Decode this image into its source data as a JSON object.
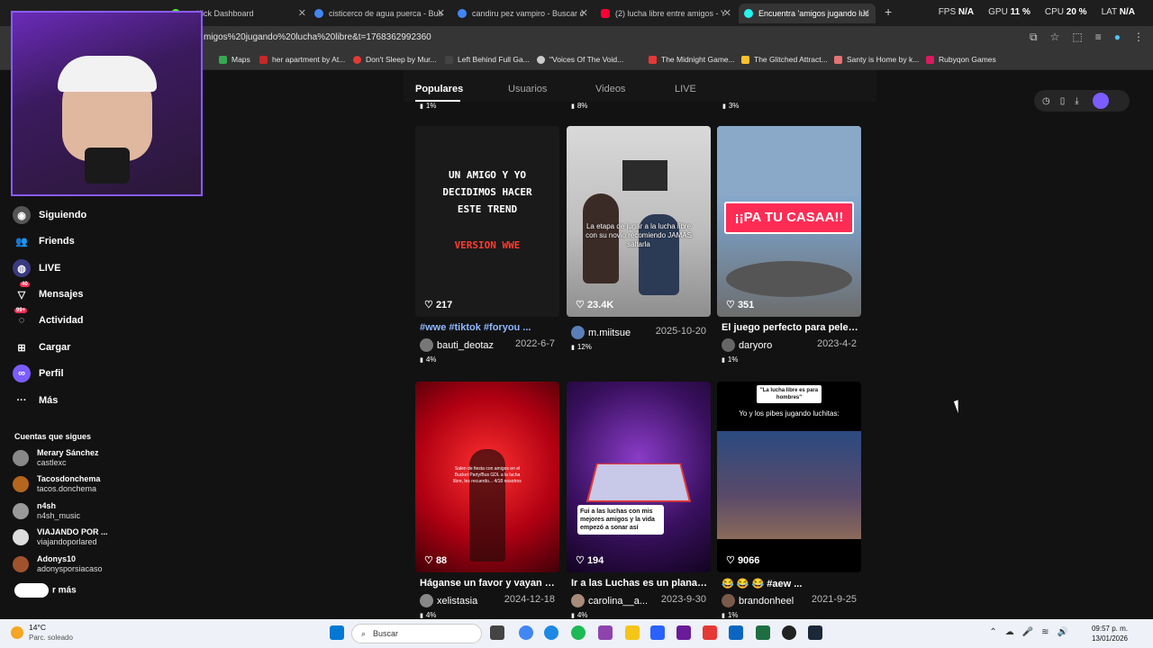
{
  "browser": {
    "tabs": [
      {
        "label": "Kick Dashboard"
      },
      {
        "label": "cisticerco de agua puerca - Bus"
      },
      {
        "label": "candiru pez vampiro - Buscar c"
      },
      {
        "label": "(2) lucha libre entre amigos - Y"
      },
      {
        "label": "Encuentra 'amigos jugando luc"
      }
    ],
    "url": "migos%20jugando%20lucha%20libre&t=1768362992360",
    "hud": {
      "fps_label": "FPS",
      "fps_value": "N/A",
      "gpu_label": "GPU",
      "gpu_value": "11 %",
      "cpu_label": "CPU",
      "cpu_value": "20 %",
      "lat_label": "LAT",
      "lat_value": "N/A"
    },
    "bookmarks": [
      {
        "label": "Maps"
      },
      {
        "label": "her apartment by At..."
      },
      {
        "label": "Don't Sleep by Mur..."
      },
      {
        "label": "Left Behind Full Ga..."
      },
      {
        "label": "\"Voices Of The Void..."
      },
      {
        "label": "The Midnight Game..."
      },
      {
        "label": "The Glitched Attract..."
      },
      {
        "label": "Santy is Home by k..."
      },
      {
        "label": "Rubyqon Games"
      }
    ]
  },
  "sidebar": {
    "nav": [
      {
        "label": "Siguiendo"
      },
      {
        "label": "Friends"
      },
      {
        "label": "LIVE"
      },
      {
        "label": "Mensajes",
        "badge": "40"
      },
      {
        "label": "Actividad",
        "badge": "99+"
      },
      {
        "label": "Cargar"
      },
      {
        "label": "Perfil"
      },
      {
        "label": "Más"
      }
    ],
    "following_title": "Cuentas que sigues",
    "accounts": [
      {
        "name": "Merary Sánchez",
        "handle": "castlexc"
      },
      {
        "name": "Tacosdonchema",
        "handle": "tacos.donchema"
      },
      {
        "name": "n4sh",
        "handle": "n4sh_music"
      },
      {
        "name": "VIAJANDO POR ...",
        "handle": "viajandoporlared"
      },
      {
        "name": "Adonys10",
        "handle": "adonysporsiacaso"
      }
    ],
    "see_more": "r más"
  },
  "search_tabs": {
    "items": [
      "Populares",
      "Usuarios",
      "Videos",
      "LIVE"
    ],
    "active": "Populares"
  },
  "top_stats": [
    "1%",
    "8%",
    "3%"
  ],
  "videos": [
    {
      "likes": "217",
      "caption": "#wwe #tiktok #foryou ...",
      "author": "bauti_deotaz",
      "date": "2022-6-7",
      "pct": "4%",
      "overlay": "UN AMIGO Y YO DECIDIMOS HACER ESTE TREND",
      "overlay2": "VERSION WWE"
    },
    {
      "likes": "23.4K",
      "caption": "",
      "author": "m.miitsue",
      "date": "2025-10-20",
      "pct": "12%",
      "overlay": "La etapa de jugar a la lucha libre con su novio recomiendo JAMAS saltarla"
    },
    {
      "likes": "351",
      "caption": "El juego perfecto para pelear...",
      "author": "daryoro",
      "date": "2023-4-2",
      "pct": "1%",
      "overlay": "¡¡PA TU CASAA!!"
    },
    {
      "likes": "88",
      "caption": "Háganse un favor y vayan a l...",
      "author": "xelistasia",
      "date": "2024-12-18",
      "pct": "4%",
      "overlay": "Salen de fiesta con amigos en el Bucket Party/Bus GDL a la lucha libre, les recuerdo... 4/18 nosotros"
    },
    {
      "likes": "194",
      "caption": "Ir a las Luchas es un planazo...",
      "author": "carolina__a...",
      "date": "2023-9-30",
      "pct": "4%",
      "overlay": "Fui a las luchas con mis mejores amigos y la vida empezó a sonar así"
    },
    {
      "likes": "9066",
      "caption": "😂 😂 😂 #aew ...",
      "author": "brandonheel",
      "date": "2021-9-25",
      "pct": "1%",
      "overlay": "\"La lucha libre es para hombres\"",
      "overlay2": "Yo y los pibes jugando luchitas:"
    }
  ],
  "taskbar": {
    "temp": "14°C",
    "condition": "Parc. soleado",
    "search_placeholder": "Buscar",
    "time": "09:57 p. m.",
    "date": "13/01/2026"
  },
  "colors": {
    "accent": "#fe2c55",
    "link": "#8fb8ff",
    "webcam_border": "#8a5cff"
  }
}
